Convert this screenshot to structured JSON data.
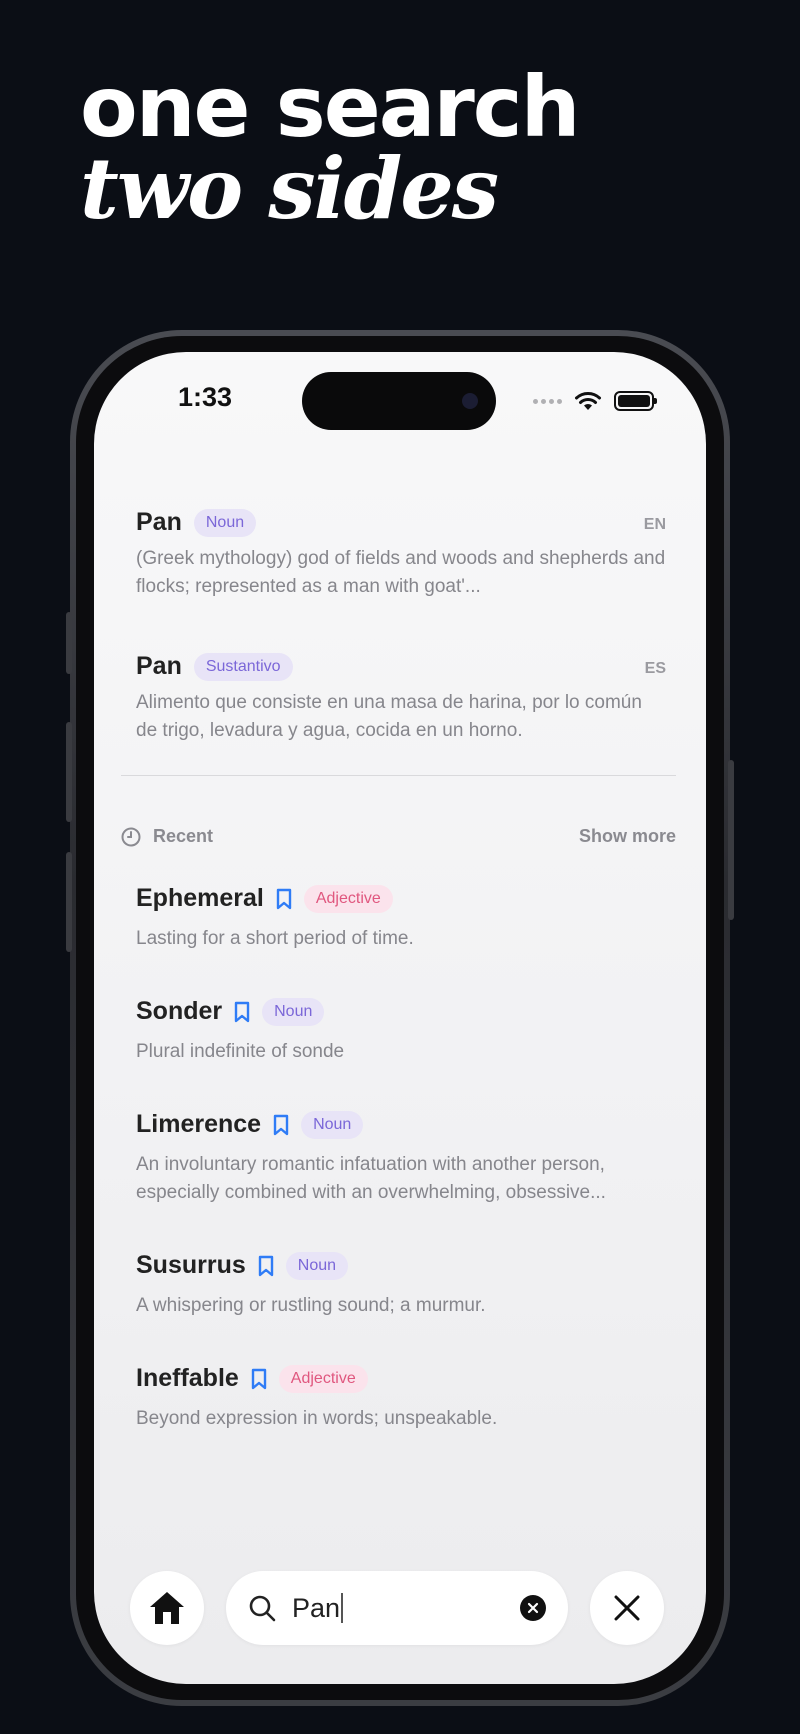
{
  "headline": {
    "line1": "one search",
    "line2": "two sides"
  },
  "status_bar": {
    "time": "1:33"
  },
  "results": [
    {
      "word": "Pan",
      "pos": "Noun",
      "lang": "EN",
      "definition": "(Greek mythology) god of fields and woods and shepherds and flocks; represented as a man with goat'..."
    },
    {
      "word": "Pan",
      "pos": "Sustantivo",
      "lang": "ES",
      "definition": "Alimento que consiste en una masa de harina, por lo común de trigo, levadura y agua, cocida en un horno."
    }
  ],
  "recent": {
    "label": "Recent",
    "show_more": "Show more",
    "items": [
      {
        "word": "Ephemeral",
        "pos": "Adjective",
        "definition": "Lasting for a short period of time."
      },
      {
        "word": "Sonder",
        "pos": "Noun",
        "definition": "Plural indefinite of sonde"
      },
      {
        "word": "Limerence",
        "pos": "Noun",
        "definition": "An involuntary romantic infatuation with another person, especially combined with an overwhelming, obsessive..."
      },
      {
        "word": "Susurrus",
        "pos": "Noun",
        "definition": "A whispering or rustling sound; a murmur."
      },
      {
        "word": "Ineffable",
        "pos": "Adjective",
        "definition": "Beyond expression in words; unspeakable."
      }
    ]
  },
  "search": {
    "value": "Pan"
  },
  "icons": {
    "home": "home-icon",
    "search": "search-icon",
    "clear": "clear-icon",
    "close": "close-icon",
    "bookmark": "bookmark-icon",
    "clock": "clock-icon"
  },
  "colors": {
    "noun_tag_bg": "#e8e4f7",
    "noun_tag_text": "#7b67d8",
    "adjective_tag_bg": "#fbe3ec",
    "adjective_tag_text": "#e0577f",
    "bookmark": "#2f7cf6"
  }
}
